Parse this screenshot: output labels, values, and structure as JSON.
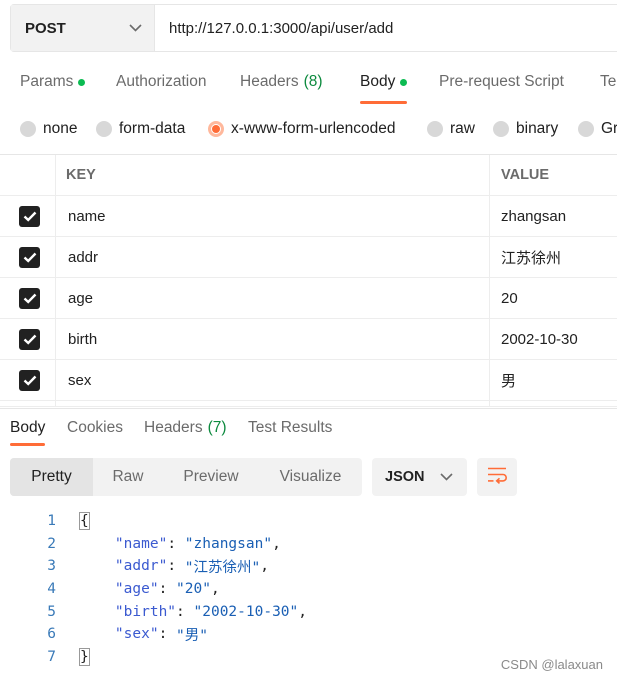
{
  "request": {
    "method": "POST",
    "url": "http://127.0.0.1:3000/api/user/add"
  },
  "request_tabs": [
    {
      "label": "Params",
      "dot": true
    },
    {
      "label": "Authorization"
    },
    {
      "label": "Headers",
      "count": "(8)"
    },
    {
      "label": "Body",
      "dot": true,
      "active": true
    },
    {
      "label": "Pre-request Script"
    },
    {
      "label": "Te"
    }
  ],
  "body_types": [
    {
      "label": "none"
    },
    {
      "label": "form-data"
    },
    {
      "label": "x-www-form-urlencoded",
      "selected": true
    },
    {
      "label": "raw"
    },
    {
      "label": "binary"
    },
    {
      "label": "Gr"
    }
  ],
  "table": {
    "key_header": "KEY",
    "value_header": "VALUE",
    "rows": [
      {
        "key": "name",
        "value": "zhangsan",
        "checked": true
      },
      {
        "key": "addr",
        "value": "江苏徐州",
        "checked": true
      },
      {
        "key": "age",
        "value": "20",
        "checked": true
      },
      {
        "key": "birth",
        "value": "2002-10-30",
        "checked": true
      },
      {
        "key": "sex",
        "value": "男",
        "checked": true
      }
    ]
  },
  "response_tabs": [
    {
      "label": "Body",
      "active": true
    },
    {
      "label": "Cookies"
    },
    {
      "label": "Headers",
      "count": "(7)"
    },
    {
      "label": "Test Results"
    }
  ],
  "view_modes": [
    "Pretty",
    "Raw",
    "Preview",
    "Visualize"
  ],
  "format": "JSON",
  "code": {
    "line_numbers": [
      "1",
      "2",
      "3",
      "4",
      "5",
      "6",
      "7"
    ],
    "open_brace": "{",
    "close_brace": "}",
    "pairs": [
      {
        "key": "\"name\"",
        "value": "\"zhangsan\"",
        "comma": ","
      },
      {
        "key": "\"addr\"",
        "value": "\"江苏徐州\"",
        "comma": ","
      },
      {
        "key": "\"age\"",
        "value": "\"20\"",
        "comma": ","
      },
      {
        "key": "\"birth\"",
        "value": "\"2002-10-30\"",
        "comma": ","
      },
      {
        "key": "\"sex\"",
        "value": "\"男\"",
        "comma": ""
      }
    ]
  },
  "watermark": "CSDN @lalaxuan",
  "colors": {
    "accent": "#ff6c37",
    "dot": "#0cbb52",
    "key": "#3b5ad0",
    "string": "#1a5fb4"
  }
}
